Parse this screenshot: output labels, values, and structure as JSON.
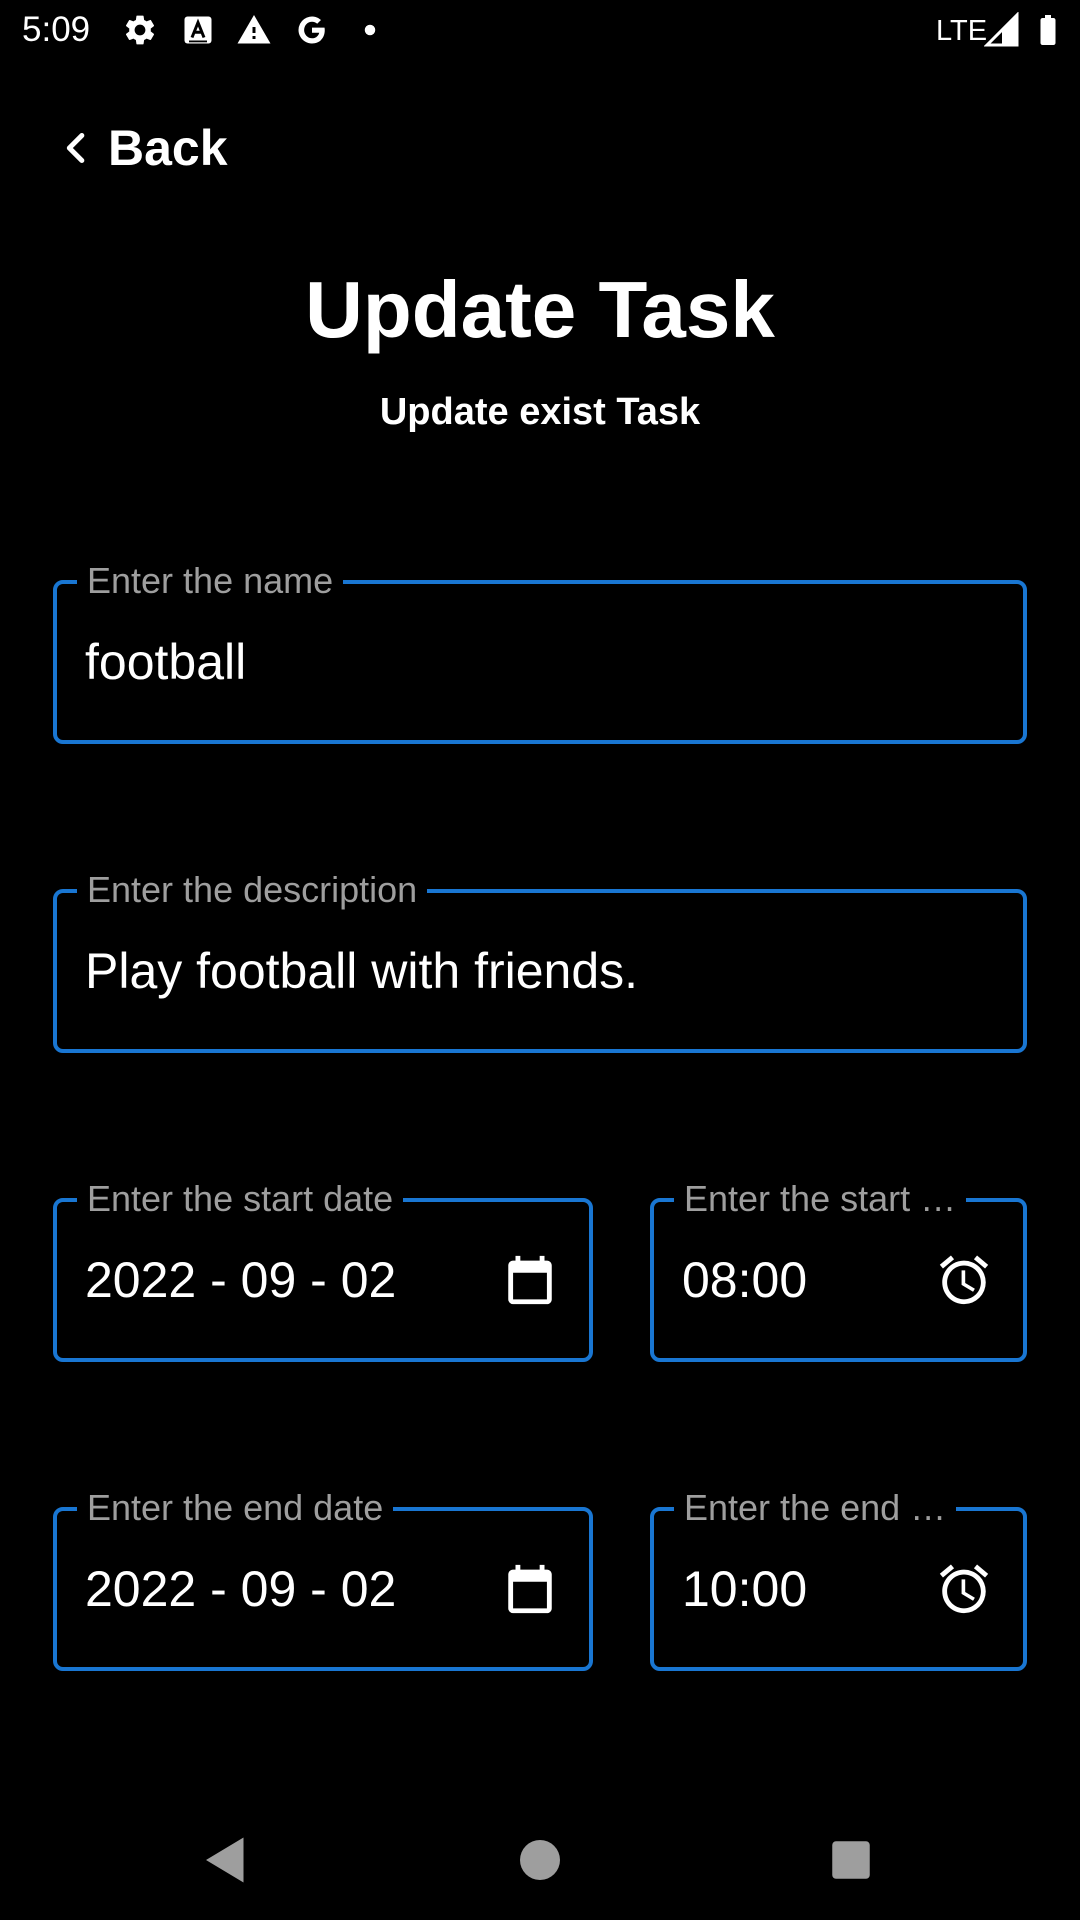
{
  "status_bar": {
    "time": "5:09",
    "network": "LTE",
    "icons": [
      "gear-icon",
      "text-a-icon",
      "warning-icon",
      "google-g-icon",
      "dot-icon",
      "signal-icon",
      "battery-icon"
    ]
  },
  "header": {
    "back_label": "Back",
    "title": "Update Task",
    "subtitle": "Update exist Task"
  },
  "form": {
    "name": {
      "label": "Enter the name",
      "value": "football"
    },
    "description": {
      "label": "Enter the description",
      "value": "Play football with friends."
    },
    "start_date": {
      "label": "Enter the start date",
      "value": "2022 - 09 - 02",
      "icon": "calendar-icon"
    },
    "start_time": {
      "label": "Enter the start …",
      "value": "08:00",
      "icon": "alarm-clock-icon"
    },
    "end_date": {
      "label": "Enter the end date",
      "value": "2022 - 09 - 02",
      "icon": "calendar-icon"
    },
    "end_time": {
      "label": "Enter the end …",
      "value": "10:00",
      "icon": "alarm-clock-icon"
    }
  },
  "nav_bar": {
    "buttons": [
      "back-triangle-icon",
      "home-circle-icon",
      "recents-square-icon"
    ]
  },
  "colors": {
    "background": "#000000",
    "accent": "#1976d2",
    "label": "#9e9e9e",
    "text": "#ffffff",
    "nav": "#9e9e9e"
  }
}
